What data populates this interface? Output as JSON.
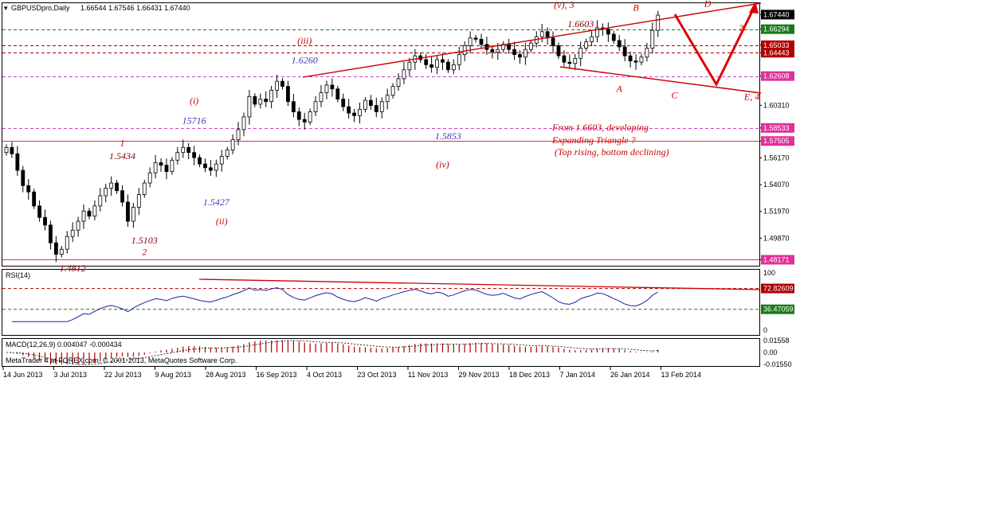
{
  "header": {
    "title": "GBPUSDpro,Daily",
    "ohlc": "1.66544 1.67546 1.66431 1.67440"
  },
  "footer": {
    "credit": "MetaTrader 4 at FOREX.com, © 2001-2013, MetaQuotes Software Corp."
  },
  "chart_data": {
    "type": "candlestick",
    "price_axis": {
      "ticks": [
        "1.67440",
        "1.66294",
        "1.65033",
        "1.64443",
        "1.62608",
        "1.60310",
        "1.58533",
        "1.57505",
        "1.56170",
        "1.54070",
        "1.51970",
        "1.49870",
        "1.48171"
      ],
      "tick_values": [
        1.6744,
        1.66294,
        1.65033,
        1.64443,
        1.62608,
        1.6031,
        1.58533,
        1.57505,
        1.5617,
        1.5407,
        1.5197,
        1.4987,
        1.48171
      ],
      "ylim": [
        1.477,
        1.684
      ],
      "tags": [
        {
          "label": "1.67440",
          "value": 1.6744,
          "bg": "#000000",
          "fg": "#ffffff"
        },
        {
          "label": "1.66294",
          "value": 1.66294,
          "bg": "#1a7a1a",
          "fg": "#ffffff"
        },
        {
          "label": "1.65033",
          "value": 1.65033,
          "bg": "#b00000",
          "fg": "#ffffff"
        },
        {
          "label": "1.64443",
          "value": 1.64443,
          "bg": "#b00000",
          "fg": "#ffffff"
        },
        {
          "label": "1.62608",
          "value": 1.62608,
          "bg": "#e0309a",
          "fg": "#ffffff"
        },
        {
          "label": "1.58533",
          "value": 1.58533,
          "bg": "#e0309a",
          "fg": "#ffffff"
        },
        {
          "label": "1.57505",
          "value": 1.57505,
          "bg": "#e0309a",
          "fg": "#ffffff"
        },
        {
          "label": "1.48171",
          "value": 1.48171,
          "bg": "#e0309a",
          "fg": "#ffffff"
        }
      ]
    },
    "hlines": [
      {
        "value": 1.66294,
        "color": "#1a7a1a",
        "style": "dash"
      },
      {
        "value": 1.65033,
        "color": "#b00000",
        "style": "dash"
      },
      {
        "value": 1.64443,
        "color": "#b00000",
        "style": "dash"
      },
      {
        "value": 1.62608,
        "color": "#cc44cc",
        "style": "dash"
      },
      {
        "value": 1.58533,
        "color": "#cc44cc",
        "style": "dash"
      },
      {
        "value": 1.57505,
        "color": "#d0306a",
        "style": "solid"
      },
      {
        "value": 1.48171,
        "color": "#d0306a",
        "style": "solid"
      }
    ],
    "dates": [
      "14 Jun 2013",
      "3 Jul 2013",
      "22 Jul 2013",
      "9 Aug 2013",
      "28 Aug 2013",
      "16 Sep 2013",
      "4 Oct 2013",
      "23 Oct 2013",
      "11 Nov 2013",
      "29 Nov 2013",
      "18 Dec 2013",
      "7 Jan 2014",
      "26 Jan 2014",
      "13 Feb 2014"
    ],
    "closes": [
      1.57,
      1.565,
      1.552,
      1.54,
      1.535,
      1.524,
      1.515,
      1.509,
      1.495,
      1.486,
      1.49,
      1.5,
      1.505,
      1.512,
      1.52,
      1.516,
      1.524,
      1.532,
      1.538,
      1.542,
      1.536,
      1.527,
      1.512,
      1.523,
      1.533,
      1.542,
      1.55,
      1.558,
      1.556,
      1.551,
      1.56,
      1.566,
      1.57,
      1.566,
      1.562,
      1.557,
      1.554,
      1.552,
      1.557,
      1.563,
      1.568,
      1.576,
      1.584,
      1.594,
      1.61,
      1.604,
      1.608,
      1.606,
      1.615,
      1.622,
      1.618,
      1.606,
      1.598,
      1.592,
      1.59,
      1.598,
      1.606,
      1.613,
      1.619,
      1.616,
      1.608,
      1.602,
      1.597,
      1.595,
      1.6,
      1.607,
      1.603,
      1.598,
      1.606,
      1.611,
      1.618,
      1.624,
      1.631,
      1.637,
      1.642,
      1.639,
      1.635,
      1.633,
      1.639,
      1.637,
      1.631,
      1.635,
      1.643,
      1.65,
      1.656,
      1.655,
      1.651,
      1.647,
      1.645,
      1.647,
      1.651,
      1.647,
      1.643,
      1.641,
      1.647,
      1.652,
      1.657,
      1.661,
      1.656,
      1.65,
      1.642,
      1.637,
      1.636,
      1.64,
      1.648,
      1.653,
      1.657,
      1.664,
      1.663,
      1.659,
      1.654,
      1.649,
      1.642,
      1.638,
      1.637,
      1.641,
      1.648,
      1.662,
      1.674
    ],
    "annotations": [
      {
        "text": "(v), 3",
        "color": "#cc0000",
        "price": 1.6795,
        "index": 101
      },
      {
        "text": "1.6603",
        "color": "#8b0000",
        "price": 1.6645,
        "index": 104
      },
      {
        "text": "B",
        "color": "#cc0000",
        "price": 1.6775,
        "index": 114
      },
      {
        "text": "D",
        "color": "#cc0000",
        "price": 1.6805,
        "index": 127
      },
      {
        "text": "(iii)",
        "color": "#cc0000",
        "price": 1.6515,
        "index": 54
      },
      {
        "text": "1.6260",
        "color": "#3a3ab8",
        "price": 1.6362,
        "index": 54
      },
      {
        "text": "(i)",
        "color": "#cc0000",
        "price": 1.6042,
        "index": 34
      },
      {
        "text": "15716",
        "color": "#3a3ab8",
        "price": 1.5885,
        "index": 34
      },
      {
        "text": "1.5853",
        "color": "#3a3ab8",
        "price": 1.5765,
        "index": 80
      },
      {
        "text": "(iv)",
        "color": "#cc0000",
        "price": 1.5542,
        "index": 79
      },
      {
        "text": "1",
        "color": "#cc0000",
        "price": 1.5712,
        "index": 21
      },
      {
        "text": "1.5434",
        "color": "#8b0000",
        "price": 1.5608,
        "index": 21
      },
      {
        "text": "1.5427",
        "color": "#3a3ab8",
        "price": 1.5245,
        "index": 38
      },
      {
        "text": "(ii)",
        "color": "#cc0000",
        "price": 1.5095,
        "index": 39
      },
      {
        "text": "1.5103",
        "color": "#8b0000",
        "price": 1.4945,
        "index": 25
      },
      {
        "text": "2",
        "color": "#cc0000",
        "price": 1.4855,
        "index": 25
      },
      {
        "text": "1.4812",
        "color": "#8b0000",
        "price": 1.4725,
        "index": 12
      },
      {
        "text": "A",
        "color": "#cc0000",
        "price": 1.6135,
        "index": 111
      },
      {
        "text": "C",
        "color": "#cc0000",
        "price": 1.6085,
        "index": 121
      },
      {
        "text": "?",
        "color": "#cc0000",
        "price": 1.6615,
        "index": 133
      },
      {
        "text": "E, 4",
        "color": "#cc0000",
        "price": 1.6075,
        "index": 135
      }
    ],
    "note_lines": [
      "From 1.6603, developing",
      "Expanding Triangle ?",
      "(Top rising, bottom declining)"
    ],
    "rsi": {
      "label": "RSI(14)",
      "levels": [
        "100",
        "72.82609",
        "36.47059",
        "0"
      ],
      "level_values": [
        100,
        72.82609,
        36.47059,
        0
      ],
      "tags": [
        "72.82609",
        "36.47059"
      ]
    },
    "macd": {
      "label": "MACD(12,26,9) 0.004047 -0.000434",
      "levels": [
        "0.01558",
        "0.00",
        "-0.01550"
      ],
      "level_values": [
        0.01558,
        0.0,
        -0.0155
      ]
    }
  }
}
